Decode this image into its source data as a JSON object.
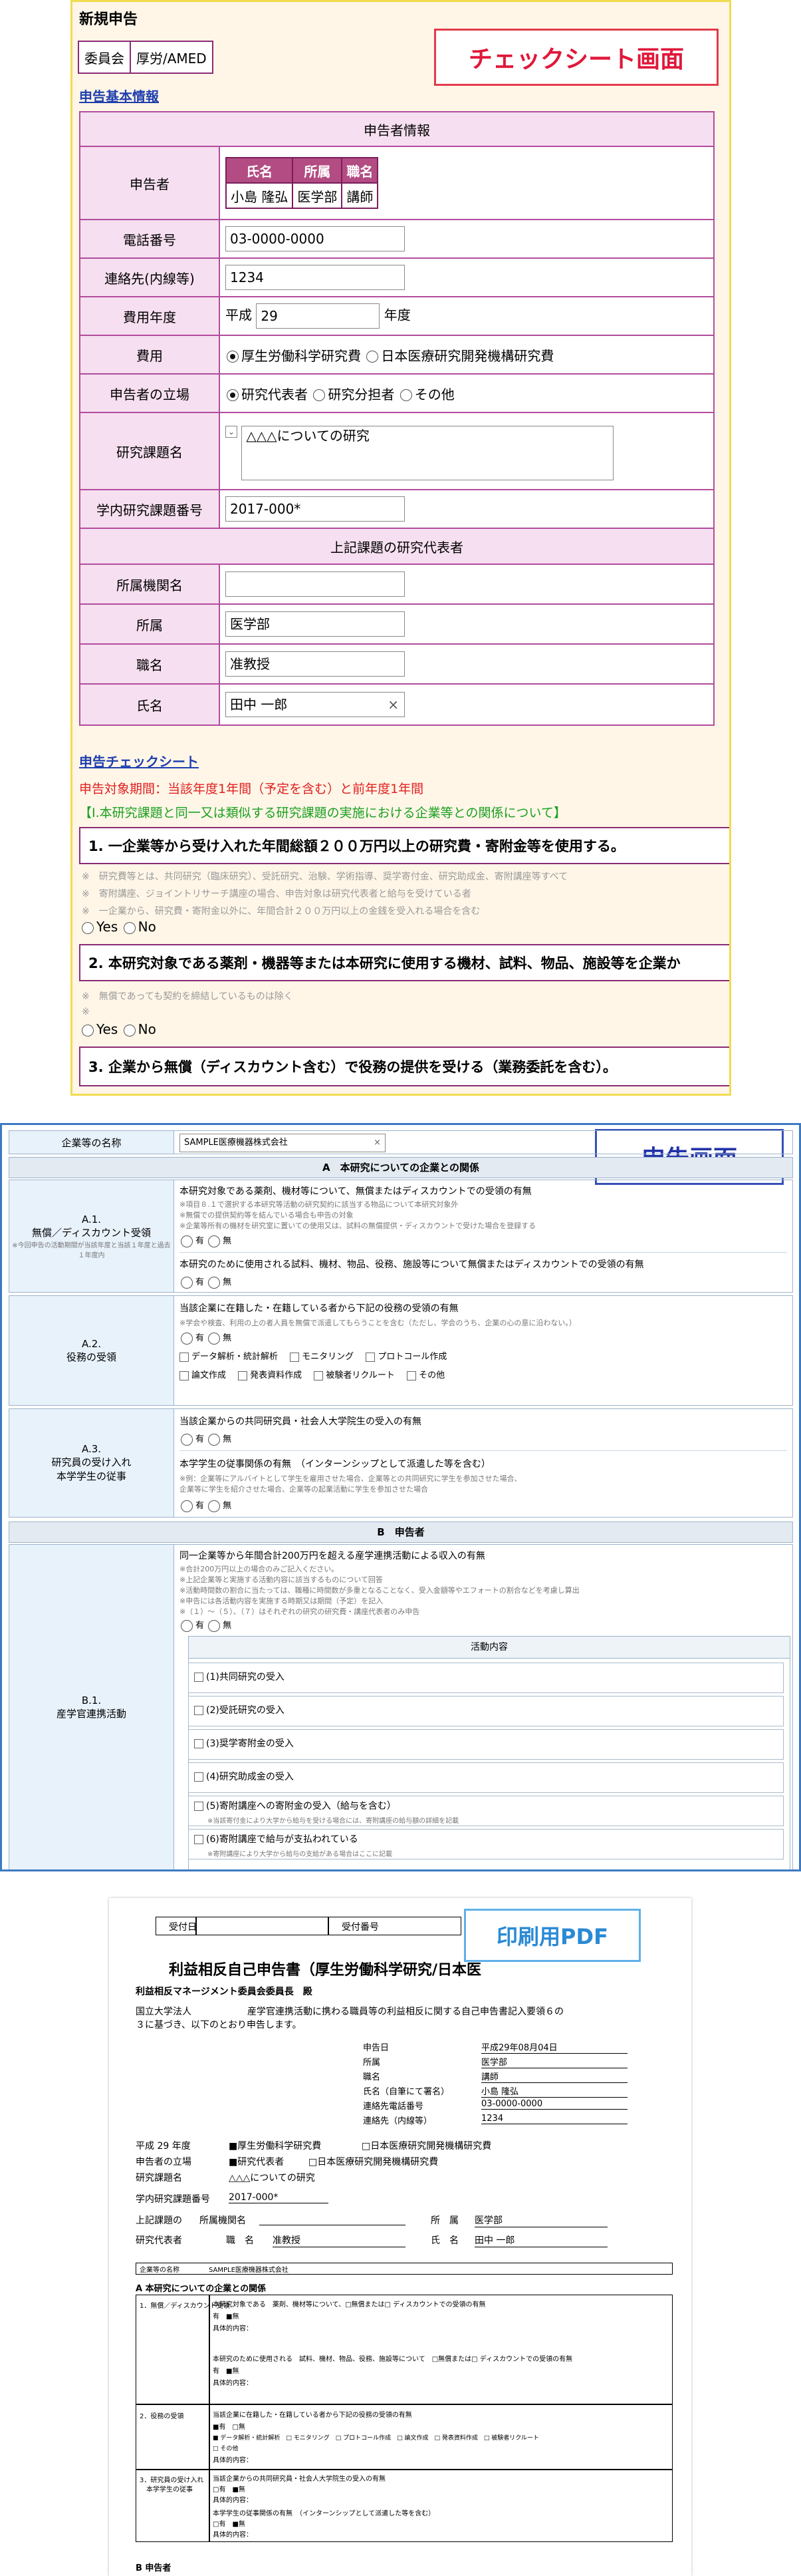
{
  "checksheet": {
    "title": "新規申告",
    "iinkai_label": "委員会",
    "iinkai_value": "厚労/AMED",
    "callout": "チェックシート画面",
    "basic_link": "申告基本情報",
    "applicant_section": "申告者情報",
    "rows": {
      "applicant": "申告者",
      "phone": "電話番号",
      "extension": "連絡先(内線等)",
      "year": "費用年度",
      "cost": "費用",
      "position": "申告者の立場",
      "research_title": "研究課題名",
      "internal_no": "学内研究課題番号"
    },
    "person_table": {
      "headers": [
        "氏名",
        "所属",
        "職名"
      ],
      "values": [
        "小島 隆弘",
        "医学部",
        "講師"
      ]
    },
    "phone_value": "03-0000-0000",
    "extension_value": "1234",
    "year_prefix": "平成",
    "year_value": "29",
    "year_suffix": "年度",
    "cost_options": [
      "厚生労働科学研究費",
      "日本医療研究開発機構研究費"
    ],
    "position_options": [
      "研究代表者",
      "研究分担者",
      "その他"
    ],
    "research_title_value": "△△△についての研究",
    "expand_icon": "expand-icon",
    "internal_no_value": "2017-000*",
    "rep_section": "上記課題の研究代表者",
    "rep_rows": {
      "org": "所属機関名",
      "dept": "所属",
      "title": "職名",
      "name": "氏名"
    },
    "rep_values": {
      "org": "",
      "dept": "医学部",
      "title": "准教授",
      "name": "田中 一郎"
    },
    "clear_icon": "×",
    "check_link": "申告チェックシート",
    "period": "申告対象期間：当該年度1年間（予定を含む）と前年度1年間",
    "green_title": "【I.本研究課題と同一又は類似する研究課題の実施における企業等との関係について】",
    "q1": "1.  一企業等から受け入れた年間総額２００万円以上の研究費・寄附金等を使用する。",
    "q1_notes": [
      "※　研究費等とは、共同研究（臨床研究）、受託研究、治験、学術指導、奨学寄付金、研究助成金、寄附講座等すべて",
      "※　寄附講座、ジョイントリサーチ講座の場合、申告対象は研究代表者と給与を受けている者",
      "※　一企業から、研究費・寄附金以外に、年間合計２００万円以上の金銭を受入れる場合を含む"
    ],
    "yes": "Yes",
    "no": "No",
    "q2": "2.  本研究対象である薬剤・機器等または本研究に使用する機材、試料、物品、施設等を企業か",
    "q2_notes": [
      "※　無償であっても契約を締結しているものは除く",
      "※"
    ],
    "q3": "3.  企業から無償（ディスカウント含む）で役務の提供を受ける（業務委託を含む）。"
  },
  "declaration": {
    "callout": "申告画面",
    "company_label": "企業等の名称",
    "company_value": "SAMPLE医療機器株式会社",
    "clear_icon": "×",
    "section_a": "A　本研究についての企業との関係",
    "a1_label": "A.1.",
    "a1_name": "無償／ディスカウント受領",
    "a1_note": "※今回申告の活動期間が当該年度と当該１年度と過去１年度内",
    "a1_q1": "本研究対象である薬剤、機材等について、無償またはディスカウントでの受領の有無",
    "a1_q1_notes": [
      "※項目８.１で選択する本研究等活動の研究契約に該当する物品について本研究対象外",
      "※無償での提供契約等を結んでいる場合も申告の対象",
      "※企業等所有の機材を研究室に置いての使用又は、試料の無償提供・ディスカウントで受けた場合を登録する"
    ],
    "yes": "有",
    "no": "無",
    "a1_q2": "本研究のために使用される試料、機材、物品、役務、施設等について無償またはディスカウントでの受領の有無",
    "a2_label": "A.2.",
    "a2_name": "役務の受領",
    "a2_q": "当該企業に在籍した・在籍している者から下記の役務の受領の有無",
    "a2_note": "※学会や検査、利用の上の者人員を無償で派遣してもらうことを含む（ただし、学会のうち、企業の心の意に沿わない。）",
    "a2_checks": [
      [
        "データ解析・統計解析",
        "モニタリング",
        "プロトコール作成"
      ],
      [
        "論文作成",
        "発表資料作成",
        "被験者リクルート",
        "その他"
      ]
    ],
    "a3_label": "A.3.",
    "a3_name1": "研究員の受け入れ",
    "a3_name2": "本学学生の従事",
    "a3_q1": "当該企業からの共同研究員・社会人大学院生の受入の有無",
    "a3_q2": "本学学生の従事関係の有無　（インターンシップとして派遣した等を含む）",
    "a3_notes": [
      "※例：企業等にアルバイトとして学生を雇用させた場合、企業等との共同研究に学生を参加させた場合、",
      "企業等に学生を紹介させた場合、企業等の起業活動に学生を参加させた場合"
    ],
    "section_b": "B　申告者",
    "b1_label": "B.1.",
    "b1_name": "産学官連携活動",
    "b1_q": "同一企業等から年間合計200万円を超える産学連携活動による収入の有無",
    "b1_notes": [
      "※合計200万円以上の場合のみご記入ください。",
      "※上記企業等と実施する活動内容に該当するものについて回答",
      "※活動時間数の割合に当たっては、職種に時間数が多重となることなく、受入金額等やエフォートの割合などを考慮し算出",
      "※申告には各活動内容を実施する時期又は期間（予定）を記入",
      "※（１）～（５）、（７）はそれぞれの研究の研究費・講座代表者のみ申告"
    ],
    "activity_header": "活動内容",
    "activities": [
      {
        "label": "(1)共同研究の受入",
        "note": ""
      },
      {
        "label": "(2)受託研究の受入",
        "note": ""
      },
      {
        "label": "(3)奨学寄附金の受入",
        "note": ""
      },
      {
        "label": "(4)研究助成金の受入",
        "note": ""
      },
      {
        "label": "(5)寄附講座への寄附金の受入（給与を含む）",
        "note": "※当該寄付金により大学から給与を受ける場合には、寄附講座の給与額の詳細を記載"
      },
      {
        "label": "(6)寄附講座で給与が支払われている",
        "note": "※寄附講座により大学から給与の支給がある場合はここに記載"
      }
    ]
  },
  "pdf": {
    "callout": "印刷用PDF",
    "uketsuke": "受付日",
    "uketsuke_no": "受付番号",
    "title": "利益相反自己申告書（厚生労働科学研究/日本医",
    "to": "利益相反マネージメント委員会委員長　殿",
    "intro1": "国立大学法人　　　　　　産学官連携活動に携わる職員等の利益相反に関する自己申告書記入要領６の",
    "intro2": "３に基づき、以下のとおり申告します。",
    "fields": [
      [
        "申告日",
        "平成29年08月04日"
      ],
      [
        "所属",
        "医学部"
      ],
      [
        "職名",
        "講師"
      ],
      [
        "氏名（自筆にて署名）",
        "小島 隆弘"
      ],
      [
        "連絡先電話番号",
        "03-0000-0000"
      ],
      [
        "連絡先（内線等）",
        "1234"
      ]
    ],
    "year_line": "平成 29 年度",
    "cost1": "■厚生労働科学研究費",
    "cost2": "□日本医療研究開発機構研究費",
    "position_label": "申告者の立場",
    "position1": "■研究代表者",
    "position2": "□日本医療研究開発機構研究費",
    "title_label": "研究課題名",
    "title_value": "△△△についての研究",
    "no_label": "学内研究課題番号",
    "no_value": "2017-000*",
    "rep_label": "上記課題の",
    "rep_label2": "研究代表者",
    "org_label": "所属機関名",
    "dept_label": "所　属",
    "dept_value": "医学部",
    "pos_label": "職　名",
    "pos_value": "准教授",
    "name_label": "氏　名",
    "name_value": "田中 一郎",
    "company_label": "企業等の名称",
    "company_value": "SAMPLE医療機器株式会社",
    "section_a": "A 本研究についての企業との関係",
    "r1_label": "1．無償／ディスカウント受領",
    "r1_q1": "本研究対象である　薬剤、機材等について、□無償または□ ディスカウントでの受領の有無",
    "r1_q2": "本研究のために使用される　試料、機材、物品、役務、施設等について　□無償または□ ディスカウントでの受領の有無",
    "r2_label": "2．役務の受領",
    "r2_q": "当該企業に在籍した・在籍している者から下記の役務の受領の有無",
    "r2_items": "■ データ解析・統計解析　□ モニタリング　□ プロトコール作成　□ 論文作成　□ 発表資料作成　□ 被験者リクルート",
    "r2_other": "□ その他",
    "r3_label": "3．研究員の受け入れ",
    "r3_label2": "本学学生の従事",
    "r3_q1": "当該企業からの共同研究員・社会人大学院生の受入の有無",
    "r3_q2": "本学学生の従事関係の有無　（インターンシップとして派遣した等を含む）",
    "yes": "有",
    "no": "無",
    "detail": "具体的内容：",
    "section_b": "B 申告者"
  }
}
